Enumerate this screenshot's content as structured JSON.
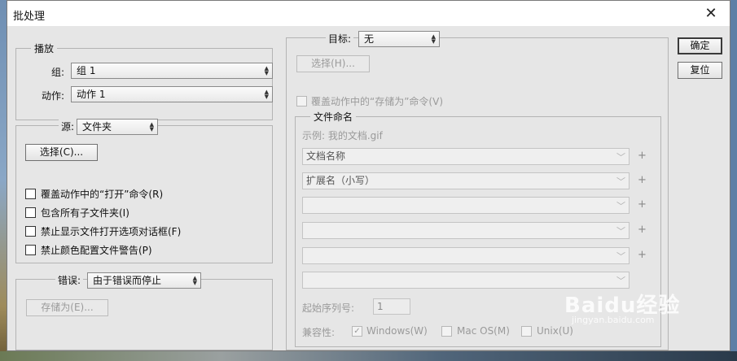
{
  "window": {
    "title": "批处理"
  },
  "buttons": {
    "ok": "确定",
    "reset": "复位"
  },
  "play": {
    "legend": "播放",
    "group_label": "组:",
    "group_value": "组 1",
    "action_label": "动作:",
    "action_value": "动作 1"
  },
  "source": {
    "label": "源:",
    "value": "文件夹",
    "choose_button": "选择(C)...",
    "options": [
      {
        "label": "覆盖动作中的“打开”命令(R)",
        "checked": false
      },
      {
        "label": "包含所有子文件夹(I)",
        "checked": false
      },
      {
        "label": "禁止显示文件打开选项对话框(F)",
        "checked": false
      },
      {
        "label": "禁止颜色配置文件警告(P)",
        "checked": false
      }
    ]
  },
  "errors": {
    "label": "错误:",
    "value": "由于错误而停止",
    "save_as_button": "存储为(E)..."
  },
  "destination": {
    "label": "目标:",
    "value": "无",
    "choose_button": "选择(H)...",
    "override_save_as": "覆盖动作中的“存储为”命令(V)"
  },
  "naming": {
    "legend": "文件命名",
    "example": "示例: 我的文档.gif",
    "fields": [
      "文档名称",
      "扩展名（小写）",
      "",
      "",
      "",
      ""
    ],
    "serial_label": "起始序列号:",
    "serial_value": "1",
    "compat_label": "兼容性:",
    "compat_options": [
      {
        "label": "Windows(W)",
        "checked": true
      },
      {
        "label": "Mac OS(M)",
        "checked": false
      },
      {
        "label": "Unix(U)",
        "checked": false
      }
    ]
  },
  "watermark": {
    "brand": "Baidu经验",
    "url": "jingyan.baidu.com"
  }
}
